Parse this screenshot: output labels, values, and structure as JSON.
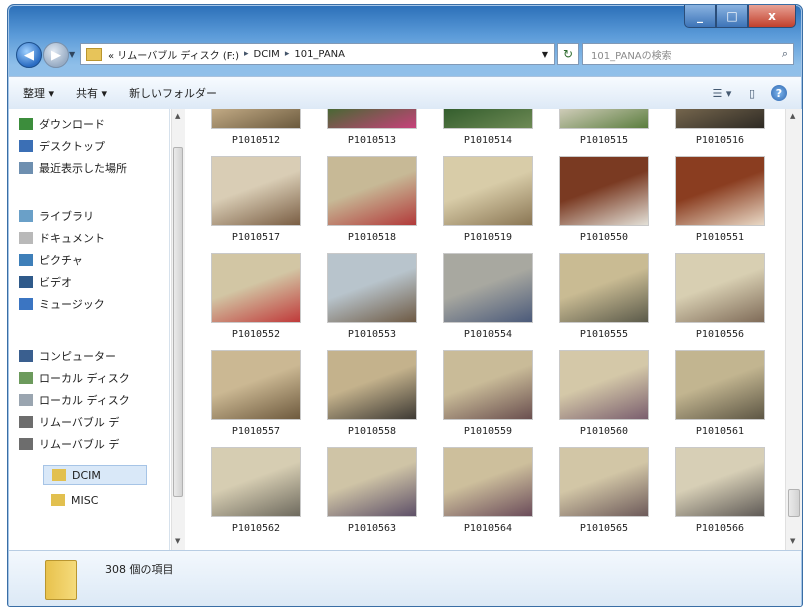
{
  "window": {
    "minimize": "_",
    "maximize": "□",
    "close": "x"
  },
  "address": {
    "crumbs": [
      "« リムーバブル ディスク (F:)",
      "DCIM",
      "101_PANA"
    ],
    "separator": "▸",
    "search_placeholder": "101_PANAの検索"
  },
  "toolbar": {
    "organize": "整理 ▾",
    "share": "共有 ▾",
    "new_folder": "新しいフォルダー"
  },
  "sidebar": {
    "items": [
      {
        "label": "ダウンロード",
        "icon": "download-folder-icon",
        "color": "#3c8d3c"
      },
      {
        "label": "デスクトップ",
        "icon": "desktop-icon",
        "color": "#3b6fb5"
      },
      {
        "label": "最近表示した場所",
        "icon": "recent-places-icon",
        "color": "#6e8fb0"
      },
      {
        "label": "ライブラリ",
        "icon": "library-icon",
        "color": "#6aa0c8"
      },
      {
        "label": "ドキュメント",
        "icon": "documents-icon",
        "color": "#b9b9b9"
      },
      {
        "label": "ピクチャ",
        "icon": "pictures-icon",
        "color": "#3e7fb9"
      },
      {
        "label": "ビデオ",
        "icon": "videos-icon",
        "color": "#2f5a8a"
      },
      {
        "label": "ミュージック",
        "icon": "music-icon",
        "color": "#3b75c2"
      },
      {
        "label": "コンピューター",
        "icon": "computer-icon",
        "color": "#3a5f8f"
      },
      {
        "label": "ローカル ディスク",
        "icon": "local-disk-icon",
        "color": "#6c9a5c"
      },
      {
        "label": "ローカル ディスク",
        "icon": "local-disk-icon",
        "color": "#9aa5b0"
      },
      {
        "label": "リムーバブル デ",
        "icon": "removable-disk-icon",
        "color": "#6d6d6d"
      },
      {
        "label": "リムーバブル デ",
        "icon": "removable-disk-icon",
        "color": "#6d6d6d"
      },
      {
        "label": "DCIM",
        "icon": "folder-icon",
        "color": "#e2c04f",
        "selected": true
      },
      {
        "label": "MISC",
        "icon": "folder-icon",
        "color": "#e2c04f"
      }
    ]
  },
  "files": [
    {
      "name": "P1010512",
      "colors": [
        "#c8b08a",
        "#6b5a3e"
      ]
    },
    {
      "name": "P1010513",
      "colors": [
        "#3f6b2e",
        "#c7417a"
      ]
    },
    {
      "name": "P1010514",
      "colors": [
        "#2f5a2a",
        "#6e8a55"
      ]
    },
    {
      "name": "P1010515",
      "colors": [
        "#d8d2c2",
        "#5b7d3e"
      ]
    },
    {
      "name": "P1010516",
      "colors": [
        "#7a6a50",
        "#2e2a24"
      ]
    },
    {
      "name": "P1010517",
      "colors": [
        "#d9cdb5",
        "#7a5e44"
      ]
    },
    {
      "name": "P1010518",
      "colors": [
        "#c7b996",
        "#b23a3a"
      ]
    },
    {
      "name": "P1010519",
      "colors": [
        "#d8cca8",
        "#8a7654"
      ]
    },
    {
      "name": "P1010550",
      "colors": [
        "#7a3a22",
        "#e3e0d7"
      ]
    },
    {
      "name": "P1010551",
      "colors": [
        "#8a3d20",
        "#e9d9c6"
      ]
    },
    {
      "name": "P1010552",
      "colors": [
        "#d2c6a4",
        "#c03a3a"
      ]
    },
    {
      "name": "P1010553",
      "colors": [
        "#b8c4cc",
        "#6e5a44"
      ]
    },
    {
      "name": "P1010554",
      "colors": [
        "#a8a8a0",
        "#4b5a7a"
      ]
    },
    {
      "name": "P1010555",
      "colors": [
        "#c9bb93",
        "#5b5a4a"
      ]
    },
    {
      "name": "P1010556",
      "colors": [
        "#d8cfb2",
        "#7f6b58"
      ]
    },
    {
      "name": "P1010557",
      "colors": [
        "#cbb893",
        "#6e5a3e"
      ]
    },
    {
      "name": "P1010558",
      "colors": [
        "#c4b28c",
        "#3e3a34"
      ]
    },
    {
      "name": "P1010559",
      "colors": [
        "#c9bb98",
        "#6a4f4f"
      ]
    },
    {
      "name": "P1010560",
      "colors": [
        "#d4c8a8",
        "#7a5e6e"
      ]
    },
    {
      "name": "P1010561",
      "colors": [
        "#c2b590",
        "#5d5644"
      ]
    },
    {
      "name": "P1010562",
      "colors": [
        "#d6cdb2",
        "#6e6a5e"
      ]
    },
    {
      "name": "P1010563",
      "colors": [
        "#cfc4a6",
        "#5e5068"
      ]
    },
    {
      "name": "P1010564",
      "colors": [
        "#cdbf9c",
        "#6b4c5a"
      ]
    },
    {
      "name": "P1010565",
      "colors": [
        "#d2c6a6",
        "#6d5a5a"
      ]
    },
    {
      "name": "P1010566",
      "colors": [
        "#d7cfb6",
        "#5f5a56"
      ]
    }
  ],
  "status": {
    "count": "308 個の項目"
  }
}
